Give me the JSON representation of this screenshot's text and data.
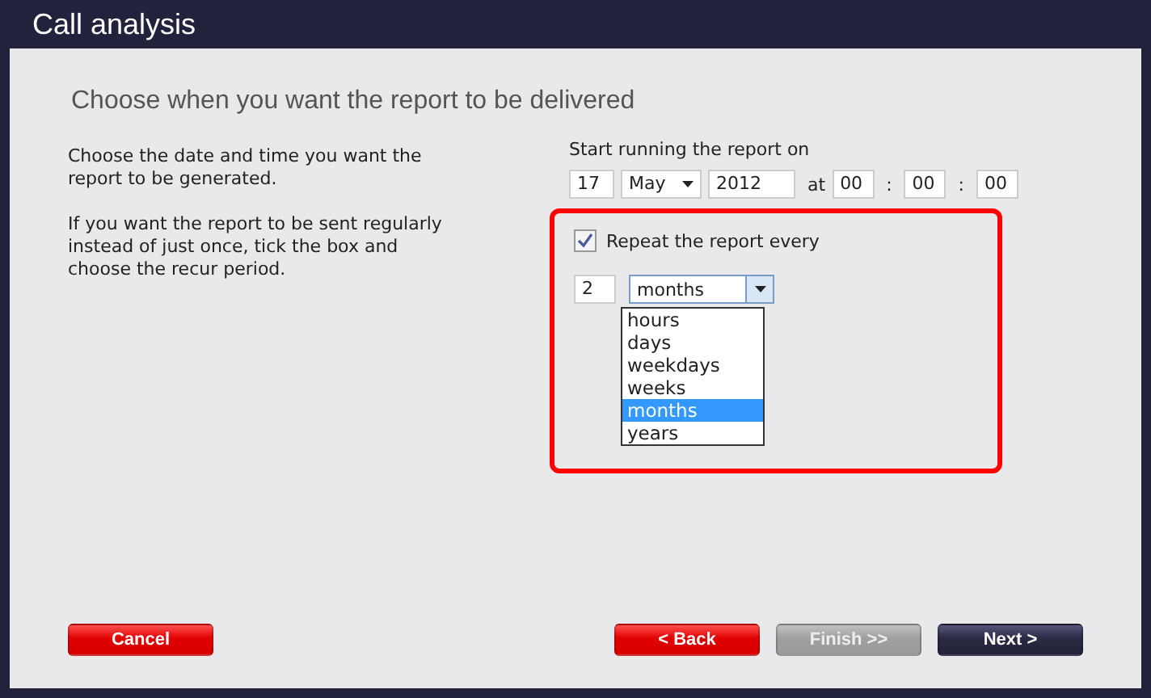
{
  "window": {
    "title": "Call analysis"
  },
  "heading": "Choose when you want the report to be delivered",
  "help_texts": [
    "Choose the date and time you want the report to be generated.",
    "If you want the report to be sent regularly instead of just once, tick the box and choose the recur period."
  ],
  "start": {
    "label": "Start running the report on",
    "day": "17",
    "month": "May",
    "year": "2012",
    "at": "at",
    "hour": "00",
    "sep1": ":",
    "minute": "00",
    "sep2": ":",
    "second": "00"
  },
  "repeat": {
    "label": "Repeat the report every",
    "checked": true,
    "count": "2",
    "period": "months",
    "expanded": true,
    "options": [
      {
        "label": "hours",
        "selected": false
      },
      {
        "label": "days",
        "selected": false
      },
      {
        "label": "weekdays",
        "selected": false
      },
      {
        "label": "weeks",
        "selected": false
      },
      {
        "label": "months",
        "selected": true
      },
      {
        "label": "years",
        "selected": false
      }
    ]
  },
  "buttons": [
    {
      "label": "Cancel",
      "kind": "danger",
      "disabled": false
    },
    {
      "label": "< Back",
      "kind": "danger",
      "disabled": false
    },
    {
      "label": "Finish >>",
      "kind": "neutral",
      "disabled": true
    },
    {
      "label": "Next >",
      "kind": "dark",
      "disabled": false
    }
  ]
}
